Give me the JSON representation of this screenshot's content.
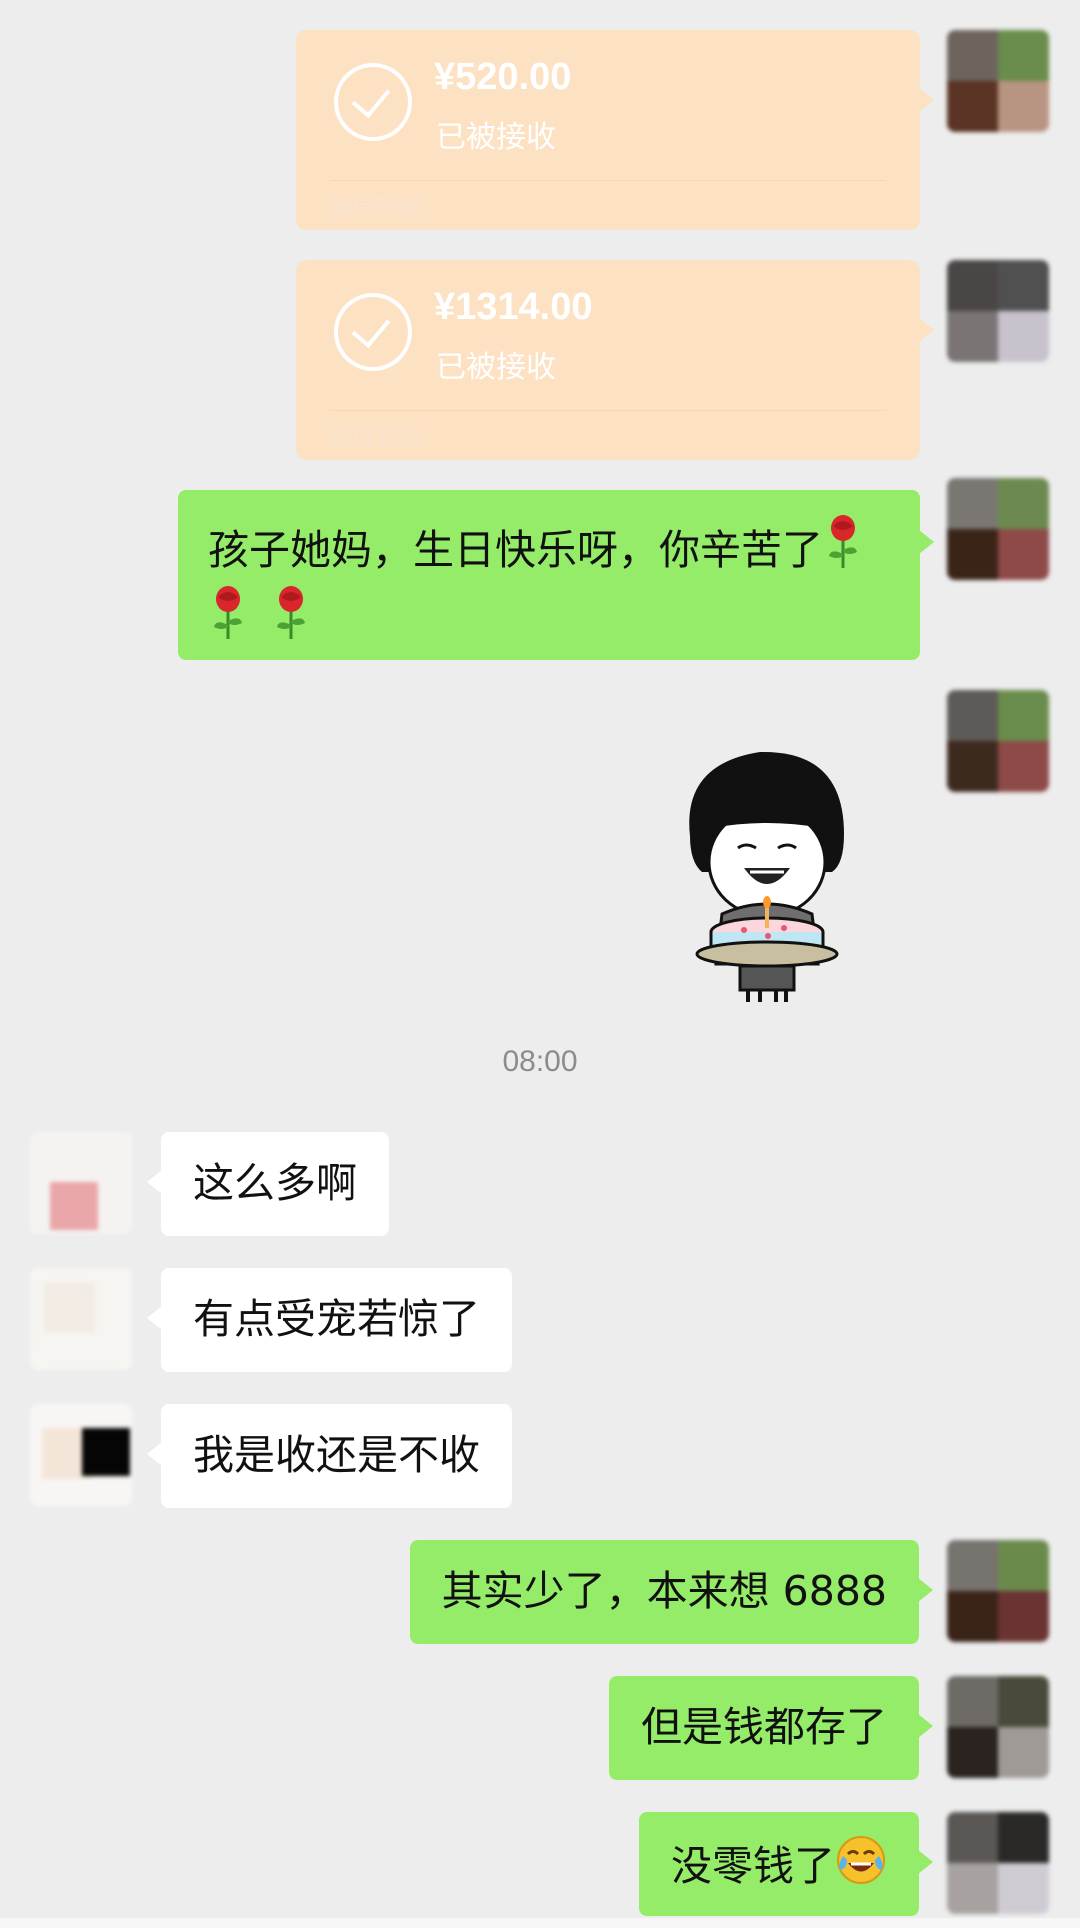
{
  "transfers": [
    {
      "amount": "¥520.00",
      "status": "已被接收",
      "label": "微信转账"
    },
    {
      "amount": "¥1314.00",
      "status": "已被接收",
      "label": "微信转账"
    }
  ],
  "messages": {
    "birthday_line1": "孩子她妈，生日快乐呀，你辛苦了",
    "reply_1": "这么多啊",
    "reply_2": "有点受宠若惊了",
    "reply_3": "我是收还是不收",
    "sent_1": "其实少了，本来想 6888",
    "sent_2": "但是钱都存了",
    "sent_3": "没零钱了"
  },
  "timestamp": "08:00",
  "icons": {
    "transfer_status": "check-circle-icon",
    "rose": "rose-emoji",
    "laugh_cry": "laugh-cry-emoji",
    "sticker": "birthday-cake-sticker"
  },
  "colors": {
    "background": "#ededed",
    "sent_bubble": "#95ec69",
    "received_bubble": "#ffffff",
    "transfer_card": "#fde1c3"
  }
}
